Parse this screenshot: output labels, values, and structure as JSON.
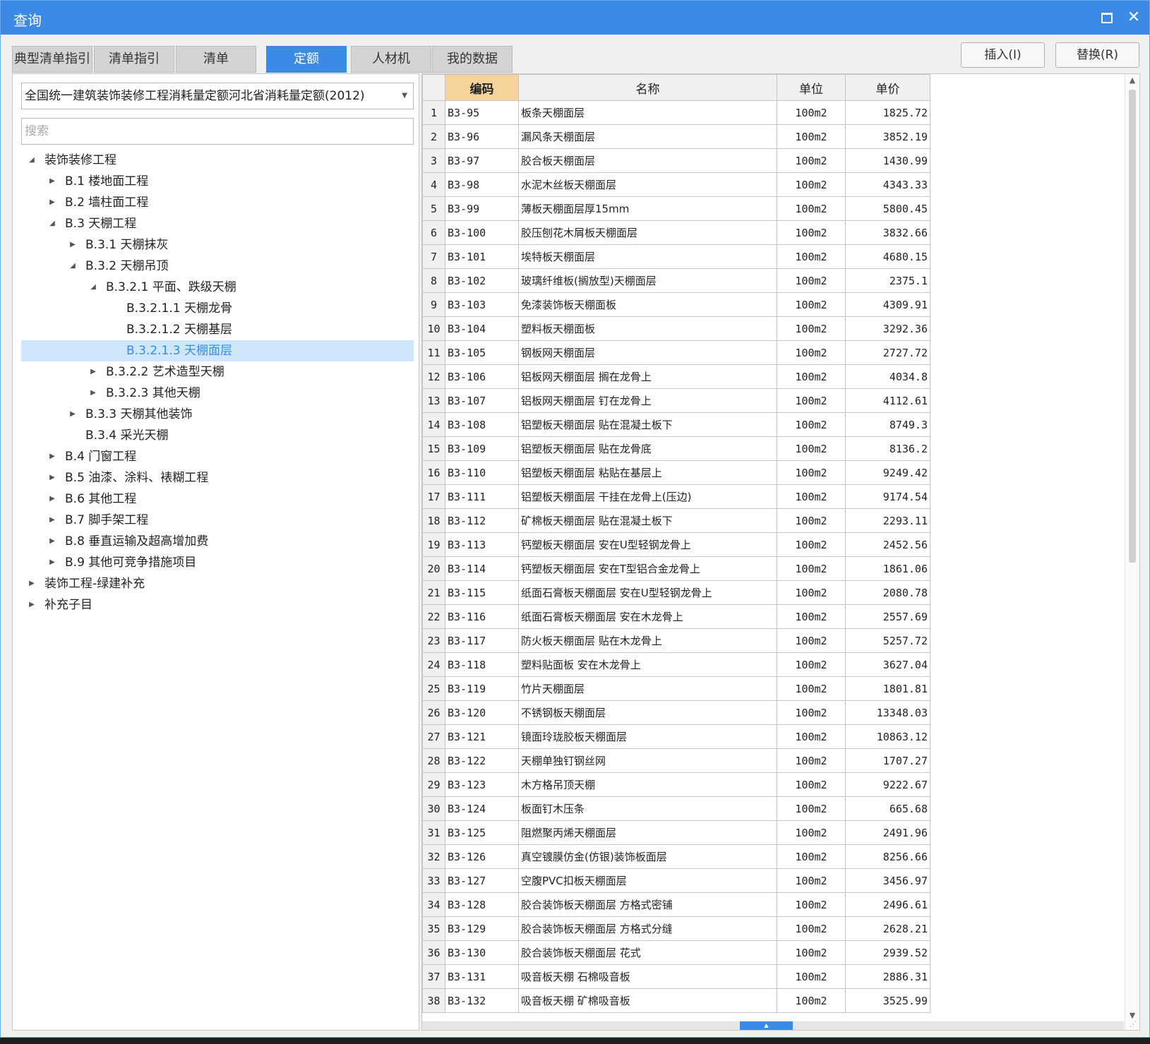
{
  "window": {
    "title": "查询"
  },
  "tabs": [
    {
      "label": "典型清单指引"
    },
    {
      "label": "清单指引"
    },
    {
      "label": "清单"
    },
    {
      "label": "定额",
      "active": true
    },
    {
      "label": "人材机"
    },
    {
      "label": "我的数据"
    }
  ],
  "actions": {
    "insert": "插入(I)",
    "replace": "替换(R)"
  },
  "left": {
    "library": "全国统一建筑装饰装修工程消耗量定额河北省消耗量定额(2012)",
    "search_placeholder": "搜索"
  },
  "tree": [
    {
      "label": "装饰装修工程",
      "level": 0,
      "state": "expanded"
    },
    {
      "label": "B.1 楼地面工程",
      "level": 1,
      "state": "collapsed"
    },
    {
      "label": "B.2 墙柱面工程",
      "level": 1,
      "state": "collapsed"
    },
    {
      "label": "B.3 天棚工程",
      "level": 1,
      "state": "expanded"
    },
    {
      "label": "B.3.1 天棚抹灰",
      "level": 2,
      "state": "collapsed"
    },
    {
      "label": "B.3.2 天棚吊顶",
      "level": 2,
      "state": "expanded"
    },
    {
      "label": "B.3.2.1 平面、跌级天棚",
      "level": 3,
      "state": "expanded"
    },
    {
      "label": "B.3.2.1.1 天棚龙骨",
      "level": 4,
      "state": "leaf"
    },
    {
      "label": "B.3.2.1.2 天棚基层",
      "level": 4,
      "state": "leaf"
    },
    {
      "label": "B.3.2.1.3 天棚面层",
      "level": 4,
      "state": "leaf",
      "selected": true
    },
    {
      "label": "B.3.2.2 艺术造型天棚",
      "level": 3,
      "state": "collapsed"
    },
    {
      "label": "B.3.2.3 其他天棚",
      "level": 3,
      "state": "collapsed"
    },
    {
      "label": "B.3.3 天棚其他装饰",
      "level": 2,
      "state": "collapsed"
    },
    {
      "label": "B.3.4 采光天棚",
      "level": 2,
      "state": "leaf"
    },
    {
      "label": "B.4 门窗工程",
      "level": 1,
      "state": "collapsed"
    },
    {
      "label": "B.5 油漆、涂料、裱糊工程",
      "level": 1,
      "state": "collapsed"
    },
    {
      "label": "B.6 其他工程",
      "level": 1,
      "state": "collapsed"
    },
    {
      "label": "B.7 脚手架工程",
      "level": 1,
      "state": "collapsed"
    },
    {
      "label": "B.8 垂直运输及超高增加费",
      "level": 1,
      "state": "collapsed"
    },
    {
      "label": "B.9 其他可竞争措施项目",
      "level": 1,
      "state": "collapsed"
    },
    {
      "label": "装饰工程-绿建补充",
      "level": 0,
      "state": "collapsed"
    },
    {
      "label": "补充子目",
      "level": 0,
      "state": "collapsed"
    }
  ],
  "grid": {
    "columns": {
      "code": "编码",
      "name": "名称",
      "unit": "单位",
      "price": "单价"
    },
    "rows": [
      {
        "no": "1",
        "code": "B3-95",
        "name": "板条天棚面层",
        "unit": "100m2",
        "price": "1825.72"
      },
      {
        "no": "2",
        "code": "B3-96",
        "name": "漏风条天棚面层",
        "unit": "100m2",
        "price": "3852.19"
      },
      {
        "no": "3",
        "code": "B3-97",
        "name": "胶合板天棚面层",
        "unit": "100m2",
        "price": "1430.99"
      },
      {
        "no": "4",
        "code": "B3-98",
        "name": "水泥木丝板天棚面层",
        "unit": "100m2",
        "price": "4343.33"
      },
      {
        "no": "5",
        "code": "B3-99",
        "name": "薄板天棚面层厚15mm",
        "unit": "100m2",
        "price": "5800.45"
      },
      {
        "no": "6",
        "code": "B3-100",
        "name": "胶压刨花木屑板天棚面层",
        "unit": "100m2",
        "price": "3832.66"
      },
      {
        "no": "7",
        "code": "B3-101",
        "name": "埃特板天棚面层",
        "unit": "100m2",
        "price": "4680.15"
      },
      {
        "no": "8",
        "code": "B3-102",
        "name": "玻璃纤维板(搁放型)天棚面层",
        "unit": "100m2",
        "price": "2375.1"
      },
      {
        "no": "9",
        "code": "B3-103",
        "name": "免漆装饰板天棚面板",
        "unit": "100m2",
        "price": "4309.91"
      },
      {
        "no": "10",
        "code": "B3-104",
        "name": "塑料板天棚面板",
        "unit": "100m2",
        "price": "3292.36"
      },
      {
        "no": "11",
        "code": "B3-105",
        "name": "钢板网天棚面层",
        "unit": "100m2",
        "price": "2727.72"
      },
      {
        "no": "12",
        "code": "B3-106",
        "name": "铝板网天棚面层 搁在龙骨上",
        "unit": "100m2",
        "price": "4034.8"
      },
      {
        "no": "13",
        "code": "B3-107",
        "name": "铝板网天棚面层 钉在龙骨上",
        "unit": "100m2",
        "price": "4112.61"
      },
      {
        "no": "14",
        "code": "B3-108",
        "name": "铝塑板天棚面层 贴在混凝土板下",
        "unit": "100m2",
        "price": "8749.3"
      },
      {
        "no": "15",
        "code": "B3-109",
        "name": "铝塑板天棚面层 贴在龙骨底",
        "unit": "100m2",
        "price": "8136.2"
      },
      {
        "no": "16",
        "code": "B3-110",
        "name": "铝塑板天棚面层 粘贴在基层上",
        "unit": "100m2",
        "price": "9249.42"
      },
      {
        "no": "17",
        "code": "B3-111",
        "name": "铝塑板天棚面层 干挂在龙骨上(压边)",
        "unit": "100m2",
        "price": "9174.54"
      },
      {
        "no": "18",
        "code": "B3-112",
        "name": "矿棉板天棚面层 贴在混凝土板下",
        "unit": "100m2",
        "price": "2293.11"
      },
      {
        "no": "19",
        "code": "B3-113",
        "name": "钙塑板天棚面层 安在U型轻钢龙骨上",
        "unit": "100m2",
        "price": "2452.56"
      },
      {
        "no": "20",
        "code": "B3-114",
        "name": "钙塑板天棚面层 安在T型铝合金龙骨上",
        "unit": "100m2",
        "price": "1861.06"
      },
      {
        "no": "21",
        "code": "B3-115",
        "name": "纸面石膏板天棚面层 安在U型轻钢龙骨上",
        "unit": "100m2",
        "price": "2080.78"
      },
      {
        "no": "22",
        "code": "B3-116",
        "name": "纸面石膏板天棚面层 安在木龙骨上",
        "unit": "100m2",
        "price": "2557.69"
      },
      {
        "no": "23",
        "code": "B3-117",
        "name": "防火板天棚面层 贴在木龙骨上",
        "unit": "100m2",
        "price": "5257.72"
      },
      {
        "no": "24",
        "code": "B3-118",
        "name": "塑料贴面板 安在木龙骨上",
        "unit": "100m2",
        "price": "3627.04"
      },
      {
        "no": "25",
        "code": "B3-119",
        "name": "竹片天棚面层",
        "unit": "100m2",
        "price": "1801.81"
      },
      {
        "no": "26",
        "code": "B3-120",
        "name": "不锈钢板天棚面层",
        "unit": "100m2",
        "price": "13348.03"
      },
      {
        "no": "27",
        "code": "B3-121",
        "name": "镜面玲珑胶板天棚面层",
        "unit": "100m2",
        "price": "10863.12"
      },
      {
        "no": "28",
        "code": "B3-122",
        "name": "天棚单独钉钢丝网",
        "unit": "100m2",
        "price": "1707.27"
      },
      {
        "no": "29",
        "code": "B3-123",
        "name": "木方格吊顶天棚",
        "unit": "100m2",
        "price": "9222.67"
      },
      {
        "no": "30",
        "code": "B3-124",
        "name": "板面钉木压条",
        "unit": "100m2",
        "price": "665.68"
      },
      {
        "no": "31",
        "code": "B3-125",
        "name": "阻燃聚丙烯天棚面层",
        "unit": "100m2",
        "price": "2491.96"
      },
      {
        "no": "32",
        "code": "B3-126",
        "name": "真空镀膜仿金(仿银)装饰板面层",
        "unit": "100m2",
        "price": "8256.66"
      },
      {
        "no": "33",
        "code": "B3-127",
        "name": "空腹PVC扣板天棚面层",
        "unit": "100m2",
        "price": "3456.97"
      },
      {
        "no": "34",
        "code": "B3-128",
        "name": "胶合装饰板天棚面层 方格式密铺",
        "unit": "100m2",
        "price": "2496.61"
      },
      {
        "no": "35",
        "code": "B3-129",
        "name": "胶合装饰板天棚面层 方格式分缝",
        "unit": "100m2",
        "price": "2628.21"
      },
      {
        "no": "36",
        "code": "B3-130",
        "name": "胶合装饰板天棚面层 花式",
        "unit": "100m2",
        "price": "2939.52"
      },
      {
        "no": "37",
        "code": "B3-131",
        "name": "吸音板天棚 石棉吸音板",
        "unit": "100m2",
        "price": "2886.31"
      },
      {
        "no": "38",
        "code": "B3-132",
        "name": "吸音板天棚 矿棉吸音板",
        "unit": "100m2",
        "price": "3525.99"
      }
    ]
  }
}
